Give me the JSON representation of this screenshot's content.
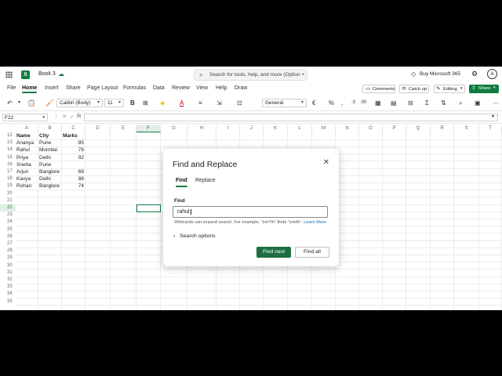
{
  "window": {
    "doc_title": "Book 3"
  },
  "search": {
    "placeholder": "Search for tools, help, and more (Option + Q)"
  },
  "title_right": {
    "buy_label": "Buy Microsoft 365",
    "avatar_initial": "A"
  },
  "tabs": [
    "File",
    "Home",
    "Insert",
    "Share",
    "Page Layout",
    "Formulas",
    "Data",
    "Review",
    "View",
    "Help",
    "Draw"
  ],
  "ribbon_right": {
    "comments": "Comments",
    "catch_up": "Catch up",
    "editing": "Editing",
    "share": "Share"
  },
  "toolbar": {
    "font_name": "Calibri (Body)",
    "font_size": "11",
    "number_format": "General"
  },
  "formula_bar": {
    "name_box": "F22"
  },
  "grid": {
    "columns": [
      "A",
      "B",
      "C",
      "D",
      "E",
      "F",
      "G",
      "H",
      "I",
      "J",
      "K",
      "L",
      "M",
      "N",
      "O",
      "P",
      "Q",
      "R",
      "S",
      "T"
    ],
    "rows": [
      "12",
      "13",
      "14",
      "15",
      "16",
      "17",
      "18",
      "19",
      "20",
      "21",
      "22",
      "23",
      "24",
      "25",
      "26",
      "27",
      "28",
      "29",
      "30",
      "31",
      "32",
      "33",
      "34",
      "35"
    ],
    "header_row": {
      "a": "Name",
      "b": "City",
      "c": "Marks"
    },
    "data": [
      {
        "name": "Ananya",
        "city": "Pune",
        "marks": "85"
      },
      {
        "name": "Rahul",
        "city": "Mumbai",
        "marks": "78"
      },
      {
        "name": "Priya",
        "city": "Delhi",
        "marks": "92"
      },
      {
        "name": "Sneha",
        "city": "Pune",
        "marks": ""
      },
      {
        "name": "Arjun",
        "city": "Banglore",
        "marks": "69"
      },
      {
        "name": "Kavya",
        "city": "Delhi",
        "marks": "88"
      },
      {
        "name": "Rohan",
        "city": "Banglore",
        "marks": "74"
      }
    ]
  },
  "dialog": {
    "title": "Find and Replace",
    "tab_find": "Find",
    "tab_replace": "Replace",
    "find_label": "Find",
    "find_value": "rahul",
    "hint": "Wildcards can expand search. For example, \"sm?th\" finds \"smith\".",
    "learn_more": "Learn More",
    "search_options": "Search options",
    "find_next": "Find next",
    "find_all": "Find all"
  },
  "colors": {
    "accent": "#107c41",
    "primary_button": "#1d6f42",
    "link": "#0f6cbd"
  }
}
